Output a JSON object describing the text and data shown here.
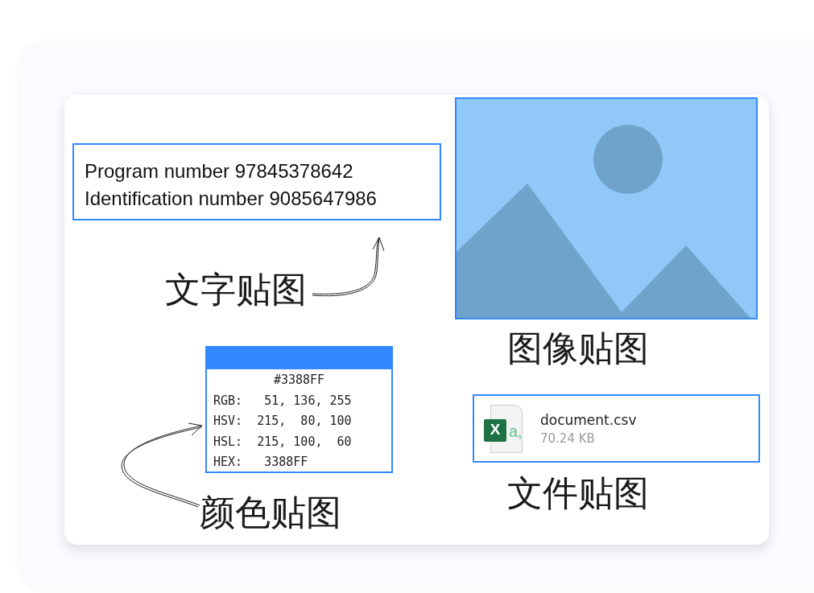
{
  "text_sticker": {
    "lines": [
      "Program number 97845378642",
      "Identification number 9085647986"
    ],
    "label": "文字贴图"
  },
  "image_sticker": {
    "label": "图像贴图"
  },
  "color_sticker": {
    "color": "#3388ff",
    "title": "#3388FF",
    "rows": [
      "RGB:   51, 136, 255",
      "HSV:  215,  80, 100",
      "HSL:  215, 100,  60",
      "HEX:   3388FF"
    ],
    "label": "颜色贴图"
  },
  "file_sticker": {
    "name": "document.csv",
    "size": "70.24 KB",
    "icon_letters": [
      "X",
      "a,"
    ],
    "label": "文件贴图"
  }
}
